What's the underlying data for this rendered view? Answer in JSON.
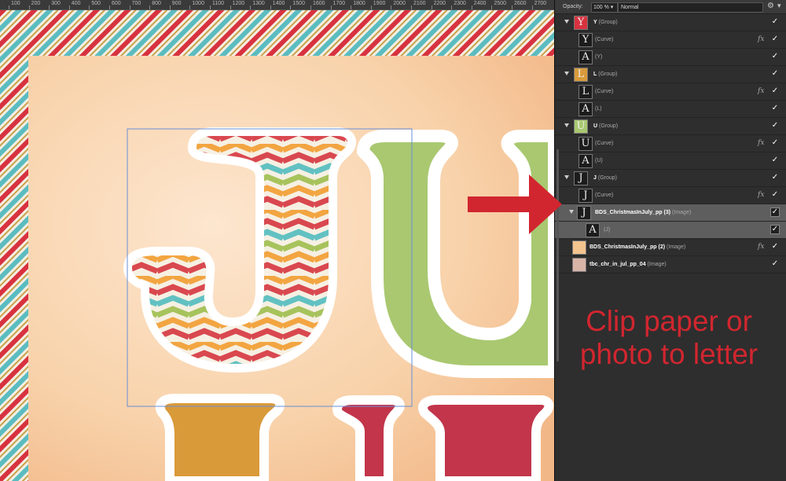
{
  "ruler": {
    "ticks": [
      "100",
      "200",
      "300",
      "400",
      "500",
      "600",
      "700",
      "800",
      "900",
      "1000",
      "1100",
      "1200",
      "1300",
      "1400",
      "1500",
      "1600",
      "1700",
      "1800",
      "1900",
      "2000",
      "2100",
      "2200",
      "2300",
      "2400",
      "2500",
      "2600",
      "2700"
    ]
  },
  "layers_panel": {
    "opacity_label": "Opacity:",
    "opacity_value": "100 % ▾",
    "blend_mode": "Normal",
    "rows": [
      {
        "name": "Y",
        "type": "(Group)",
        "thumb": "Y",
        "fx": "",
        "check": "✓"
      },
      {
        "name": "",
        "type": "(Curve)",
        "thumb": "Y",
        "fx": "fx",
        "check": "✓"
      },
      {
        "name": "",
        "type": "(Y)",
        "thumb": "A",
        "fx": "",
        "check": "✓"
      },
      {
        "name": "L",
        "type": "(Group)",
        "thumb": "L",
        "fx": "",
        "check": "✓"
      },
      {
        "name": "",
        "type": "(Curve)",
        "thumb": "L",
        "fx": "fx",
        "check": "✓"
      },
      {
        "name": "",
        "type": "(L)",
        "thumb": "A",
        "fx": "",
        "check": "✓"
      },
      {
        "name": "U",
        "type": "(Group)",
        "thumb": "U",
        "fx": "",
        "check": "✓"
      },
      {
        "name": "",
        "type": "(Curve)",
        "thumb": "U",
        "fx": "fx",
        "check": "✓"
      },
      {
        "name": "",
        "type": "(U)",
        "thumb": "A",
        "fx": "",
        "check": "✓"
      },
      {
        "name": "J",
        "type": "(Group)",
        "thumb": "J",
        "fx": "",
        "check": "✓"
      },
      {
        "name": "",
        "type": "(Curve)",
        "thumb": "J",
        "fx": "fx",
        "check": "✓"
      },
      {
        "name": "BDS_ChristmasInJuly_pp (3)",
        "type": "(Image)",
        "thumb": "J",
        "fx": "",
        "check": "✓"
      },
      {
        "name": "",
        "type": "(J)",
        "thumb": "A",
        "fx": "",
        "check": "✓"
      },
      {
        "name": "BDS_ChristmasInJuly_pp (2)",
        "type": "(Image)",
        "thumb": "",
        "fx": "fx",
        "check": "✓"
      },
      {
        "name": "tbc_chr_in_jul_pp_04",
        "type": "(Image)",
        "thumb": "",
        "fx": "",
        "check": "✓"
      }
    ]
  },
  "caption": {
    "line1": "Clip paper or",
    "line2": "photo to letter"
  },
  "colors": {
    "accent_red": "#d1262f",
    "panel_bg": "#2e2e2e",
    "letter_green": "#a9c870",
    "letter_orange": "#d99a3a",
    "letter_red": "#c2354a"
  }
}
